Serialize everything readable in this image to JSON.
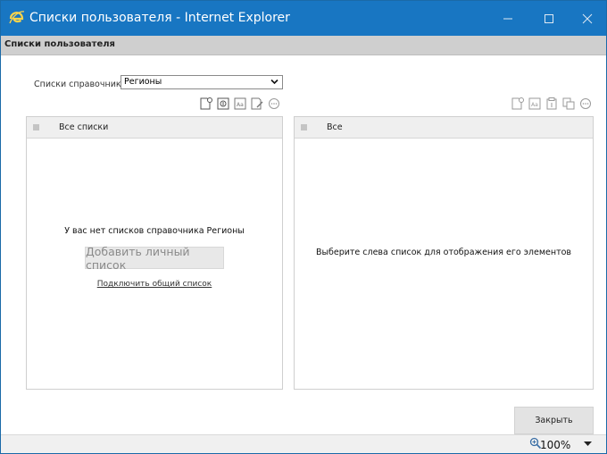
{
  "window": {
    "title": "Списки пользователя - Internet Explorer",
    "colors": {
      "titlebar": "#1876c2",
      "header_strip": "#cfcfcf"
    }
  },
  "app_header": {
    "label": "Списки пользователя"
  },
  "reference": {
    "label": "Списки справочников:",
    "selected": "Регионы"
  },
  "left_panel": {
    "header": "Все списки",
    "empty_message": "У вас нет списков справочника Регионы",
    "add_button": "Добавить личный список",
    "connect_link": "Подключить общий список",
    "toolbar_icons": [
      "new-list-icon",
      "import-icon",
      "rename-icon",
      "edit-icon",
      "more-icon"
    ]
  },
  "right_panel": {
    "header": "Все",
    "hint": "Выберите слева список для отображения его элементов",
    "toolbar_icons": [
      "new-element-icon",
      "rename-icon",
      "paste-icon",
      "copy-icon",
      "more-icon"
    ]
  },
  "footer": {
    "close_button": "Закрыть"
  },
  "statusbar": {
    "zoom": "100%"
  }
}
